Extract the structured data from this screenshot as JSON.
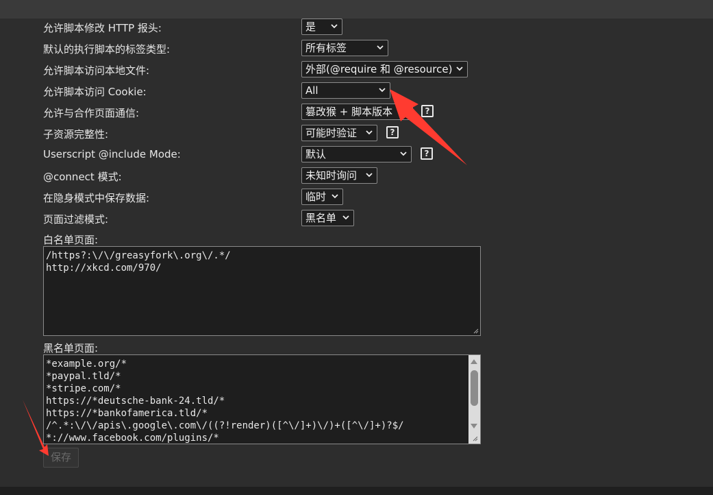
{
  "settings": [
    {
      "label": "允许脚本修改 HTTP 报头:",
      "value": "是",
      "help": false
    },
    {
      "label": "默认的执行脚本的标签类型:",
      "value": "所有标签",
      "help": false
    },
    {
      "label": "允许脚本访问本地文件:",
      "value": "外部(@require 和 @resource)",
      "help": false
    },
    {
      "label": "允许脚本访问 Cookie:",
      "value": "All",
      "help": false
    },
    {
      "label": "允许与合作页面通信:",
      "value": "篡改猴 + 脚本版本",
      "help": true
    },
    {
      "label": "子资源完整性:",
      "value": "可能时验证",
      "help": true
    },
    {
      "label": "Userscript @include Mode:",
      "value": "默认",
      "help": true
    },
    {
      "label": "@connect 模式:",
      "value": "未知时询问",
      "help": false
    },
    {
      "label": "在隐身模式中保存数据:",
      "value": "临时",
      "help": false
    },
    {
      "label": "页面过滤模式:",
      "value": "黑名单",
      "help": false
    }
  ],
  "help_icon": "?",
  "whitelist": {
    "label": "白名单页面:",
    "lines": [
      "/https?:\\/\\/greasyfork\\.org\\/.*/",
      "http://xkcd.com/970/"
    ]
  },
  "blacklist": {
    "label": "黑名单页面:",
    "lines": [
      "*example.org/*",
      "*paypal.tld/*",
      "*stripe.com/*",
      "https://*deutsche-bank-24.tld/*",
      "https://*bankofamerica.tld/*",
      "/^.*:\\/\\/apis\\.google\\.com\\/((?!render)([^\\/]+)\\/)+([^\\/]+)?$/",
      "*://www.facebook.com/plugins/*"
    ]
  },
  "save_label": "保存",
  "colors": {
    "annotation_arrow": "#ff3b30",
    "background": "#2d2d2d"
  }
}
